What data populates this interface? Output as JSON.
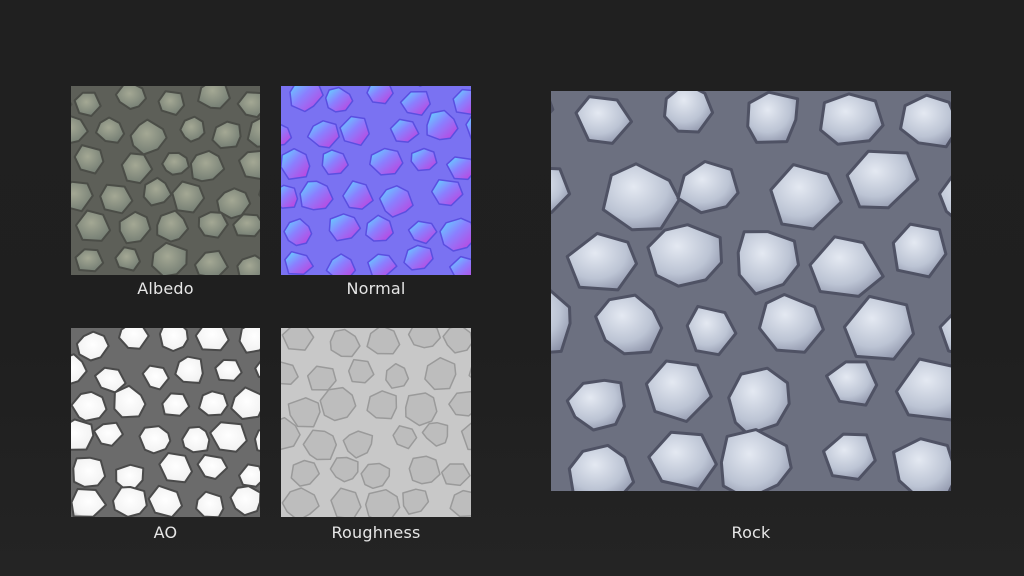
{
  "maps": {
    "albedo": {
      "label": "Albedo"
    },
    "normal": {
      "label": "Normal"
    },
    "ao": {
      "label": "AO"
    },
    "roughness": {
      "label": "Roughness"
    }
  },
  "preview": {
    "label": "Rock"
  },
  "colors": {
    "background": "#202020",
    "label_text": "#e6e6e6",
    "albedo_stone": "#7f8a88",
    "albedo_mortar": "#5d5f58",
    "normal_base": "#7a72f2",
    "ao_stone": "#f7f7f7",
    "ao_mortar": "#6b6b6b",
    "roughness_base": "#c8c8c8",
    "rock_stone": "#c9cfdc",
    "rock_mortar": "#6c7080"
  }
}
